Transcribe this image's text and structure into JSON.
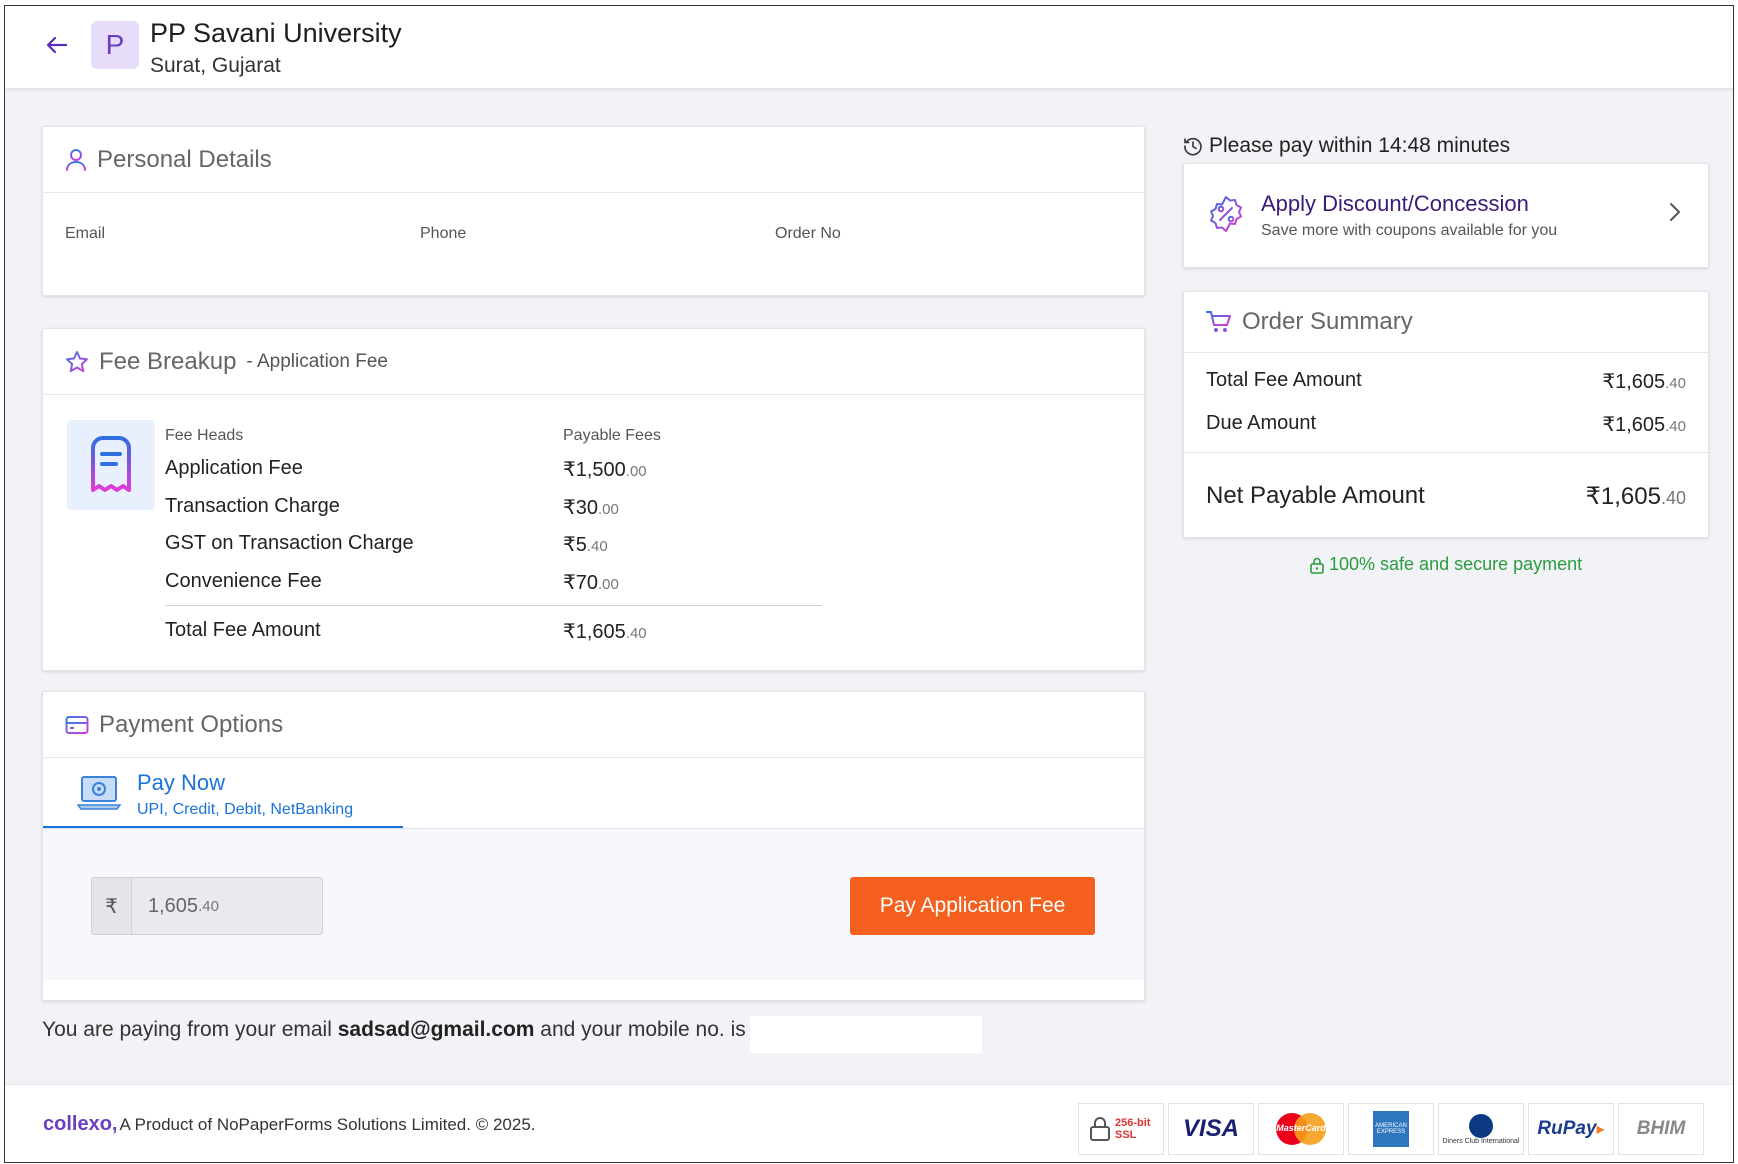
{
  "header": {
    "university_name": "PP Savani University",
    "location": "Surat, Gujarat",
    "logo_letter": "P"
  },
  "personal_details": {
    "title": "Personal Details",
    "labels": {
      "email": "Email",
      "phone": "Phone",
      "order_no": "Order No"
    }
  },
  "fee_breakup": {
    "title": "Fee Breakup",
    "subtitle": "- Application Fee",
    "col_heads": "Fee Heads",
    "col_payable": "Payable Fees",
    "rows": [
      {
        "name": "Application Fee",
        "whole": "₹1,500",
        "dec": ".00"
      },
      {
        "name": "Transaction Charge",
        "whole": "₹30",
        "dec": ".00"
      },
      {
        "name": "GST on Transaction Charge",
        "whole": "₹5",
        "dec": ".40"
      },
      {
        "name": "Convenience Fee",
        "whole": "₹70",
        "dec": ".00"
      }
    ],
    "total": {
      "name": "Total Fee Amount",
      "whole": "₹1,605",
      "dec": ".40"
    }
  },
  "payment_options": {
    "title": "Payment Options",
    "tab_title": "Pay Now",
    "tab_subtitle": "UPI, Credit, Debit, NetBanking",
    "currency_symbol": "₹",
    "amount_whole": "1,605",
    "amount_dec": ".40",
    "pay_button": "Pay Application Fee"
  },
  "paying_note": {
    "prefix": "You are paying from your email",
    "email": "sadsad@gmail.com",
    "suffix": "and your mobile no. is"
  },
  "timer": {
    "text": "Please pay within 14:48 minutes"
  },
  "discount": {
    "title": "Apply Discount/Concession",
    "subtitle": "Save more with coupons available for you"
  },
  "order_summary": {
    "title": "Order Summary",
    "total_label": "Total Fee Amount",
    "total_whole": "₹1,605",
    "total_dec": ".40",
    "due_label": "Due Amount",
    "due_whole": "₹1,605",
    "due_dec": ".40",
    "net_label": "Net Payable Amount",
    "net_whole": "₹1,605",
    "net_dec": ".40"
  },
  "secure_text": "100% safe and secure payment",
  "footer": {
    "brand": "collexo,",
    "text": "A Product of NoPaperForms Solutions Limited. © 2025.",
    "badges": {
      "ssl": "256-bit SSL",
      "visa": "VISA",
      "mastercard": "MasterCard",
      "amex": "AMERICAN EXPRESS",
      "diners": "Diners Club International",
      "rupay": "RuPay",
      "bhim": "BHIM"
    }
  },
  "colors": {
    "accent_blue": "#1a73d9",
    "accent_purple": "#3b1a78",
    "pay_button": "#f5601e",
    "secure_green": "#2b9c3e"
  }
}
